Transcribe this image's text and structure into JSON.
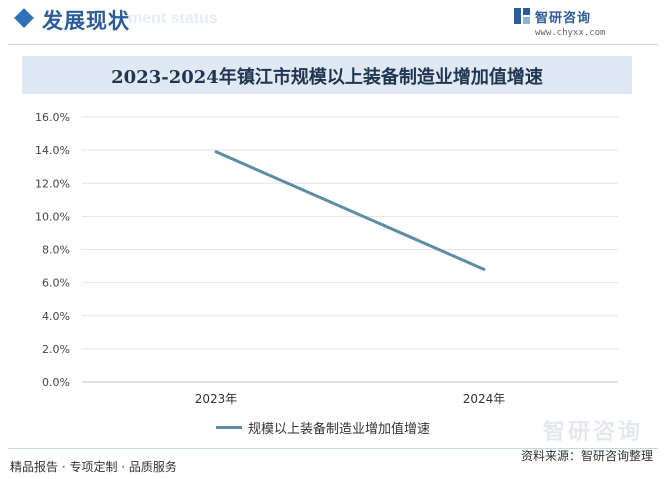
{
  "header": {
    "section_title": "发展现状",
    "section_subtitle": "ment status",
    "brand_name": "智研咨询",
    "brand_url": "www.chyxx.com"
  },
  "footer": {
    "left_text": "精品报告 · 专项定制 · 品质服务",
    "source_text": "资料来源：智研咨询整理",
    "watermark": "智研咨询"
  },
  "colors": {
    "accent": "#2f6fb5",
    "series": "#5d8da0",
    "title_band": "#dfe8f3"
  },
  "chart_data": {
    "type": "line",
    "title": "2023-2024年镇江市规模以上装备制造业增加值增速",
    "categories": [
      "2023年",
      "2024年"
    ],
    "series": [
      {
        "name": "规模以上装备制造业增加值增速",
        "values": [
          13.9,
          6.8
        ]
      }
    ],
    "ylim": [
      0,
      16
    ],
    "yticks": [
      "0.0%",
      "2.0%",
      "4.0%",
      "6.0%",
      "8.0%",
      "10.0%",
      "12.0%",
      "14.0%",
      "16.0%"
    ],
    "ytick_values": [
      0,
      2,
      4,
      6,
      8,
      10,
      12,
      14,
      16
    ],
    "grid": true,
    "legend_position": "bottom"
  }
}
